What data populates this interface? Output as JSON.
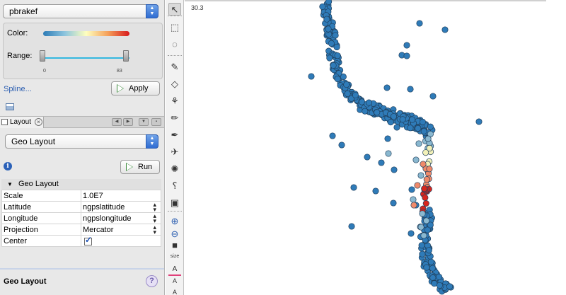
{
  "mapping": {
    "attribute_select": "pbrakef",
    "color_label": "Color:",
    "range_label": "Range:",
    "range_min": "0",
    "range_max": "83",
    "spline_link": "Spline...",
    "apply_button": "Apply"
  },
  "tab": {
    "label": "Layout"
  },
  "layout": {
    "layout_select": "Geo Layout",
    "run_button": "Run",
    "section_title": "Geo Layout",
    "properties": [
      {
        "key": "Scale",
        "value": "1.0E7",
        "control": "text"
      },
      {
        "key": "Latitude",
        "value": "ngpslatitude",
        "control": "stepper"
      },
      {
        "key": "Longitude",
        "value": "ngpslongitude",
        "control": "stepper"
      },
      {
        "key": "Projection",
        "value": "Mercator",
        "control": "stepper"
      },
      {
        "key": "Center",
        "value": "",
        "control": "checkbox",
        "checked": true
      }
    ],
    "footer_title": "Geo Layout",
    "help_icon": "?"
  },
  "toolbar": {
    "tools": [
      "pointer-icon",
      "marquee-select-icon",
      "lasso-icon",
      "brush-icon",
      "diamond-icon",
      "tree-icon",
      "pencil-icon",
      "pen-icon",
      "airplane-icon",
      "gear-flower-icon",
      "question-cursor-icon",
      "network-icon",
      "zoom-in-icon",
      "zoom-out-icon",
      "square-icon",
      "size-icon",
      "color-text-icon",
      "text-icon",
      "text-small-icon"
    ],
    "size_label": "size"
  },
  "canvas": {
    "readout": "30.3",
    "colors": {
      "base": "#2f7bb8",
      "low": "#8ab8d0",
      "mid": "#f2f0b8",
      "high": "#f08a6a",
      "max": "#d7261e"
    }
  }
}
